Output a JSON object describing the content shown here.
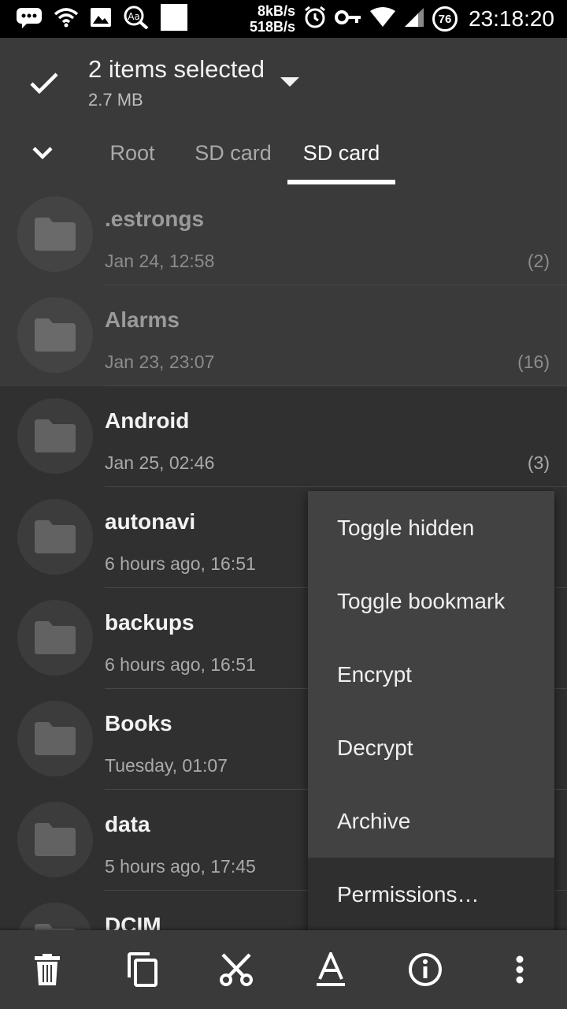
{
  "status_bar": {
    "speed_up": "8kB/s",
    "speed_down": "518B/s",
    "battery": "76",
    "time": "23:18:20",
    "icons": [
      "chat-icon",
      "wifi-icon",
      "image-icon",
      "font-search-icon",
      "white-square-icon",
      "alarm-icon",
      "key-icon",
      "wifi-signal-icon",
      "cell-signal-icon",
      "battery-icon"
    ]
  },
  "selection_bar": {
    "title": "2 items selected",
    "size": "2.7 MB",
    "check_icon": "check-icon",
    "dropdown_icon": "caret-down-icon"
  },
  "breadcrumb": {
    "collapse_icon": "chevron-down-icon",
    "tabs": [
      {
        "label": "Root",
        "active": false
      },
      {
        "label": "SD card",
        "active": false
      },
      {
        "label": "SD card",
        "active": true
      }
    ]
  },
  "files": [
    {
      "name": ".estrongs",
      "date": "Jan 24, 12:58",
      "count": "(2)",
      "selected": true
    },
    {
      "name": "Alarms",
      "date": "Jan 23, 23:07",
      "count": "(16)",
      "selected": true
    },
    {
      "name": "Android",
      "date": "Jan 25, 02:46",
      "count": "(3)",
      "selected": false
    },
    {
      "name": "autonavi",
      "date": "6 hours ago, 16:51",
      "count": "",
      "selected": false
    },
    {
      "name": "backups",
      "date": "6 hours ago, 16:51",
      "count": "",
      "selected": false
    },
    {
      "name": "Books",
      "date": "Tuesday, 01:07",
      "count": "",
      "selected": false
    },
    {
      "name": "data",
      "date": "5 hours ago, 17:45",
      "count": "",
      "selected": false
    },
    {
      "name": "DCIM",
      "date": "",
      "count": "",
      "selected": false
    }
  ],
  "context_menu": {
    "items": [
      "Toggle hidden",
      "Toggle bookmark",
      "Encrypt",
      "Decrypt",
      "Archive",
      "Permissions…"
    ]
  },
  "bottom_bar": {
    "actions": [
      "delete-icon",
      "copy-icon",
      "cut-icon",
      "rename-icon",
      "info-icon",
      "more-vert-icon"
    ]
  },
  "colors": {
    "status_bar": "#000000",
    "app_bar": "#3a3a3a",
    "background": "#303030",
    "menu": "#424242",
    "accent": "#ffffff"
  }
}
